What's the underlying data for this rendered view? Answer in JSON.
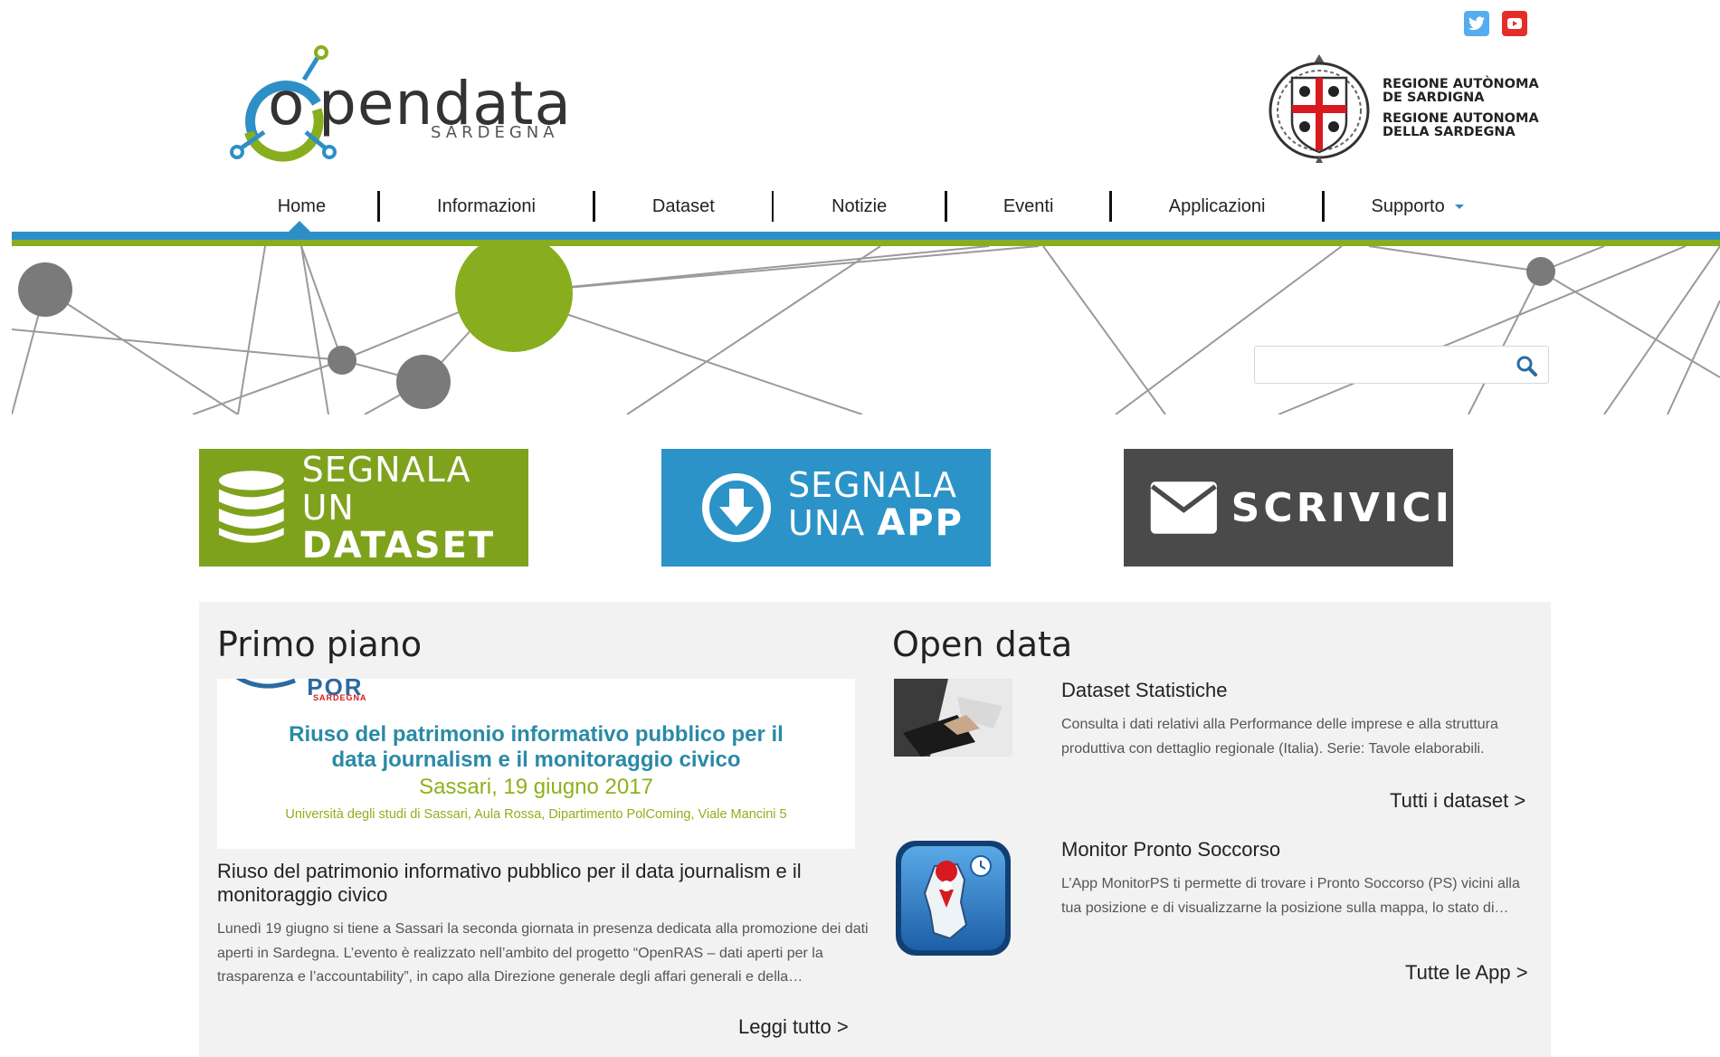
{
  "social": {
    "twitter": "twitter-icon",
    "youtube": "youtube-icon",
    "colors": {
      "twitter": "#55acee",
      "youtube": "#e52d27"
    }
  },
  "logo": {
    "word": "pendata",
    "letter": "o",
    "sub": "SARDEGNA"
  },
  "region": {
    "line1": "REGIONE AUTÒNOMA",
    "line2": "DE SARDIGNA",
    "line3": "REGIONE AUTONOMA",
    "line4": "DELLA SARDEGNA"
  },
  "nav": {
    "home": "Home",
    "informazioni": "Informazioni",
    "dataset": "Dataset",
    "notizie": "Notizie",
    "eventi": "Eventi",
    "applicazioni": "Applicazioni",
    "supporto": "Supporto"
  },
  "search": {
    "placeholder": "",
    "value": ""
  },
  "banners": {
    "b1_line1": "SEGNALA UN",
    "b1_line2": "DATASET",
    "b2_line1": "SEGNALA",
    "b2_line2a": "UNA ",
    "b2_line2b": "APP",
    "b3": "SCRIVICI"
  },
  "primo_piano": {
    "heading": "Primo piano",
    "image": {
      "logo": "POR",
      "logo_sub": "SARDEGNA",
      "title": "Riuso del patrimonio informativo pubblico per il data journalism e il monitoraggio civico",
      "date": "Sassari, 19 giugno 2017",
      "place": "Università degli studi di Sassari, Aula Rossa, Dipartimento PolComing, Viale Mancini 5"
    },
    "title": "Riuso del patrimonio informativo pubblico per il data journalism e il monitoraggio civico",
    "body": "Lunedì 19 giugno si tiene a Sassari la seconda giornata in presenza dedicata alla promozione dei dati aperti in Sardegna. L’evento è realizzato nell’ambito del progetto “OpenRAS – dati aperti per la trasparenza e l’accountability”, in capo alla Direzione generale degli affari generali e della…",
    "read_more": "Leggi tutto >"
  },
  "open_data": {
    "heading": "Open data",
    "item1": {
      "title": "Dataset Statistiche",
      "body": "Consulta i dati relativi alla Performance delle imprese e alla struttura produttiva con dettaglio regionale (Italia). Serie: Tavole elaborabili."
    },
    "all_datasets": "Tutti i dataset >",
    "item2": {
      "title": "Monitor Pronto Soccorso",
      "body": "L’App MonitorPS ti permette di trovare i Pronto Soccorso (PS) vicini alla tua posizione e di visualizzarne la posizione sulla mappa, lo stato di…"
    },
    "all_apps": "Tutte le App >"
  },
  "colors": {
    "blue": "#2e8fc6",
    "green": "#88ae1f",
    "dark": "#4a4a4a"
  }
}
